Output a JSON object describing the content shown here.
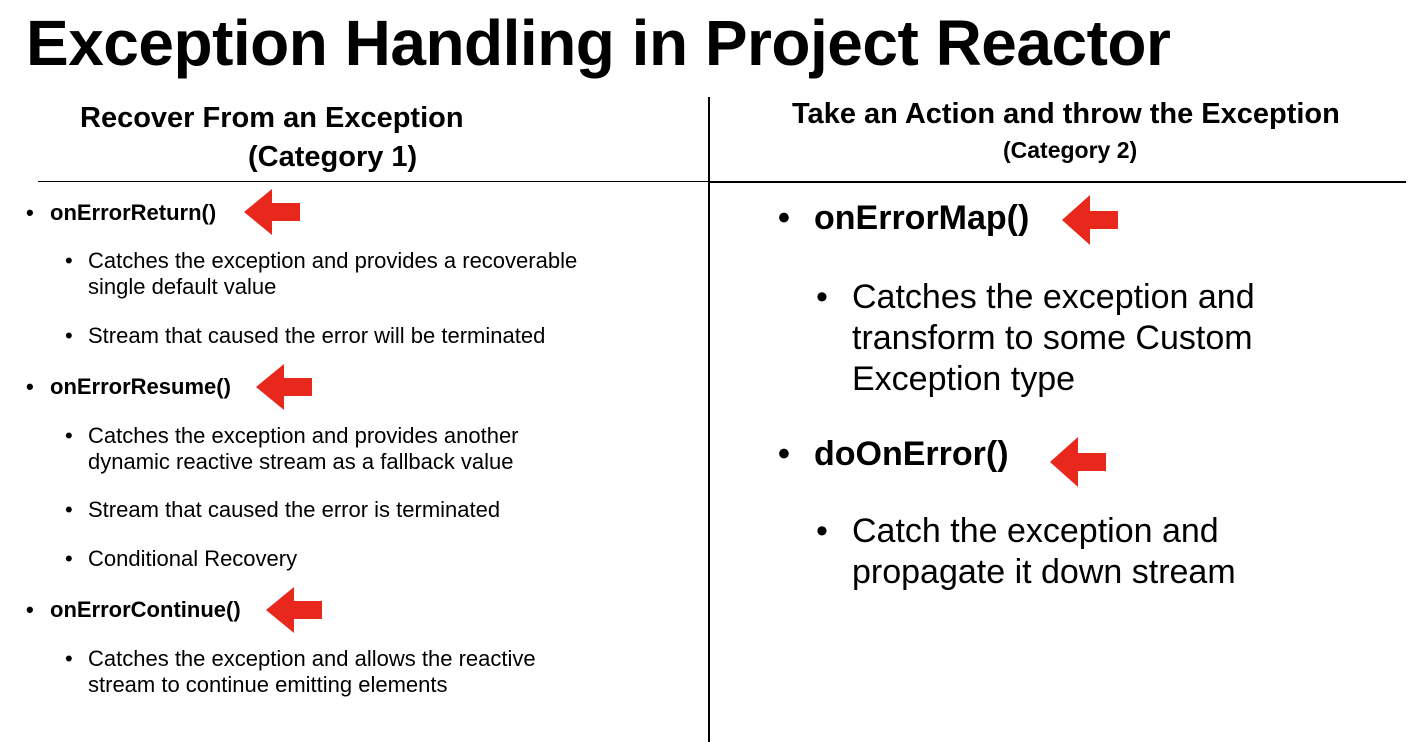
{
  "title": "Exception Handling in Project Reactor",
  "left": {
    "heading": "Recover From an Exception",
    "category": "(Category 1)",
    "items": [
      {
        "name": "onErrorReturn()",
        "subs": [
          [
            "Catches the exception and provides a recoverable",
            "single default value"
          ],
          [
            "Stream that caused the error will be terminated"
          ]
        ]
      },
      {
        "name": "onErrorResume()",
        "subs": [
          [
            "Catches the exception and provides another",
            "dynamic reactive stream as a fallback value"
          ],
          [
            "Stream that caused the error is terminated"
          ],
          [
            "Conditional Recovery"
          ]
        ]
      },
      {
        "name": "onErrorContinue()",
        "subs": [
          [
            "Catches the exception and allows the reactive",
            "stream to continue emitting elements"
          ]
        ]
      }
    ]
  },
  "right": {
    "heading": "Take an Action and throw the Exception",
    "category": "(Category 2)",
    "items": [
      {
        "name": "onErrorMap()",
        "subs": [
          [
            "Catches the exception and",
            "transform to some Custom",
            "Exception type"
          ]
        ]
      },
      {
        "name": "doOnError()",
        "subs": [
          [
            "Catch the exception and",
            "propagate it down stream"
          ]
        ]
      }
    ]
  },
  "bullet_char": "•",
  "colors": {
    "arrow": "#e8281c",
    "text": "#000000",
    "background": "#ffffff"
  },
  "icons": {
    "pointer": "red-left-arrow-icon"
  }
}
